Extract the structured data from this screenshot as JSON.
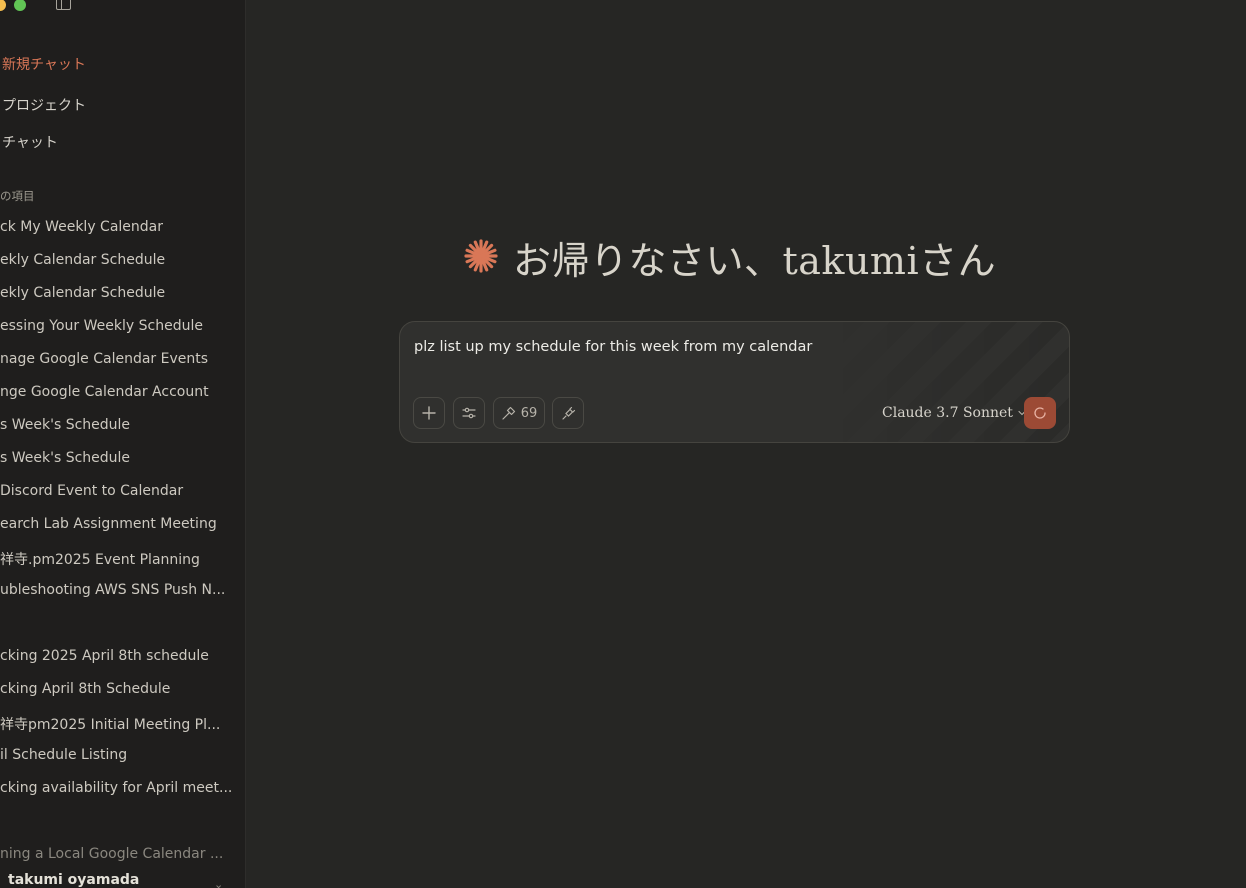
{
  "sidebar": {
    "nav": {
      "new_chat": "新規チャット",
      "projects": "プロジェクト",
      "chats": "チャット"
    },
    "recents_label": "の項目",
    "chats": [
      "ck My Weekly Calendar",
      "ekly Calendar Schedule",
      "ekly Calendar Schedule",
      "essing Your Weekly Schedule",
      "nage Google Calendar Events",
      "nge Google Calendar Account",
      "s Week's Schedule",
      "s Week's Schedule",
      " Discord Event to Calendar",
      "earch Lab Assignment Meeting",
      "祥寺.pm2025 Event Planning",
      "ubleshooting AWS SNS Push N..."
    ],
    "group_label_2": "",
    "chats_2": [
      "cking 2025 April 8th schedule",
      "cking April 8th Schedule",
      "祥寺pm2025 Initial Meeting Pl...",
      "il Schedule Listing",
      "cking availability for April meet..."
    ],
    "group_label_3": "",
    "chats_3": [
      "ning a Local Google Calendar ..."
    ],
    "account_name": "takumi oyamada",
    "accent_color": "#d97757"
  },
  "main": {
    "greeting": "お帰りなさい、takumiさん",
    "composer": {
      "value": "plz list up my schedule for this week from my calendar",
      "tools_count": "69",
      "model": "Claude 3.7 Sonnet"
    },
    "send_color": "#9c4a35"
  }
}
